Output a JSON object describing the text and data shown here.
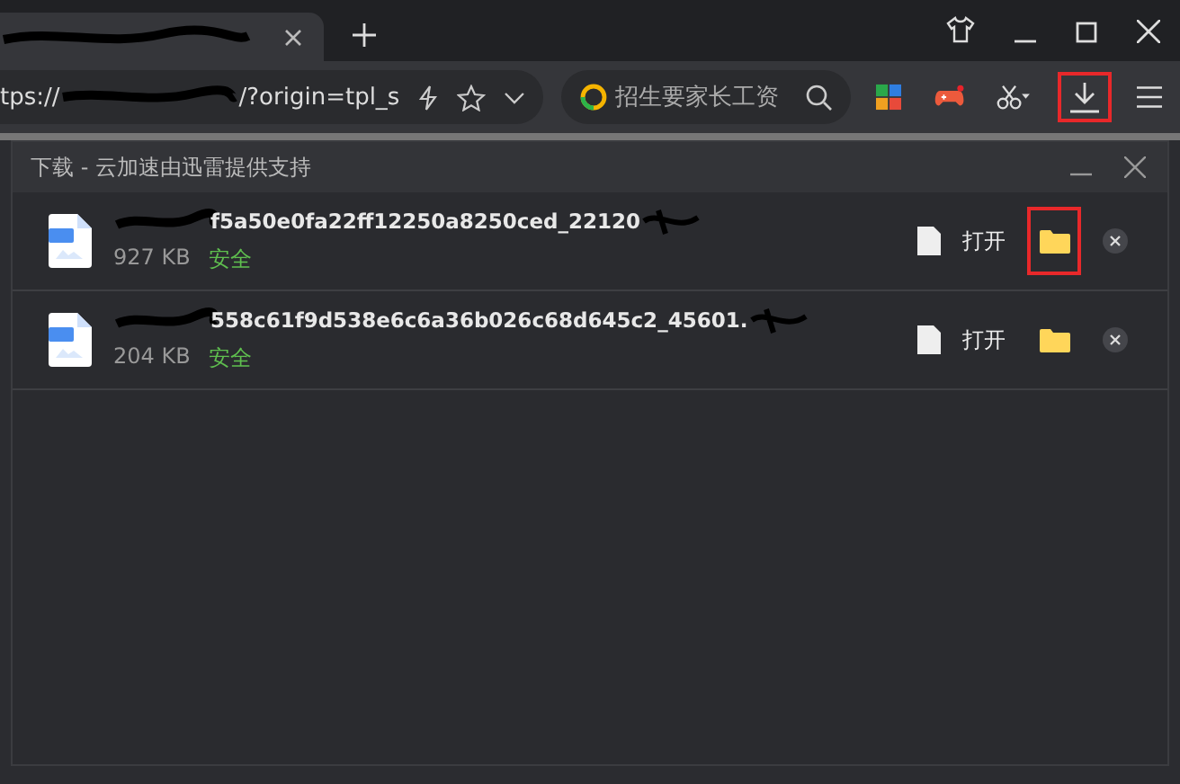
{
  "address_bar": {
    "url_start": "tps://",
    "url_end": "/?origin=tpl_s"
  },
  "search": {
    "value": "招生要家长工资"
  },
  "toolbar": {
    "download_highlighted": true
  },
  "download_panel": {
    "title": "下载 - 云加速由迅雷提供支持",
    "items": [
      {
        "name_visible": "f5a50e0fa22ff12250a8250ced_22120",
        "size": "927 KB",
        "status": "安全",
        "open_label": "打开",
        "highlighted": true
      },
      {
        "name_visible": "558c61f9d538e6c6a36b026c68d645c2_45601.",
        "size": "204 KB",
        "status": "安全",
        "open_label": "打开",
        "highlighted": false
      }
    ]
  }
}
